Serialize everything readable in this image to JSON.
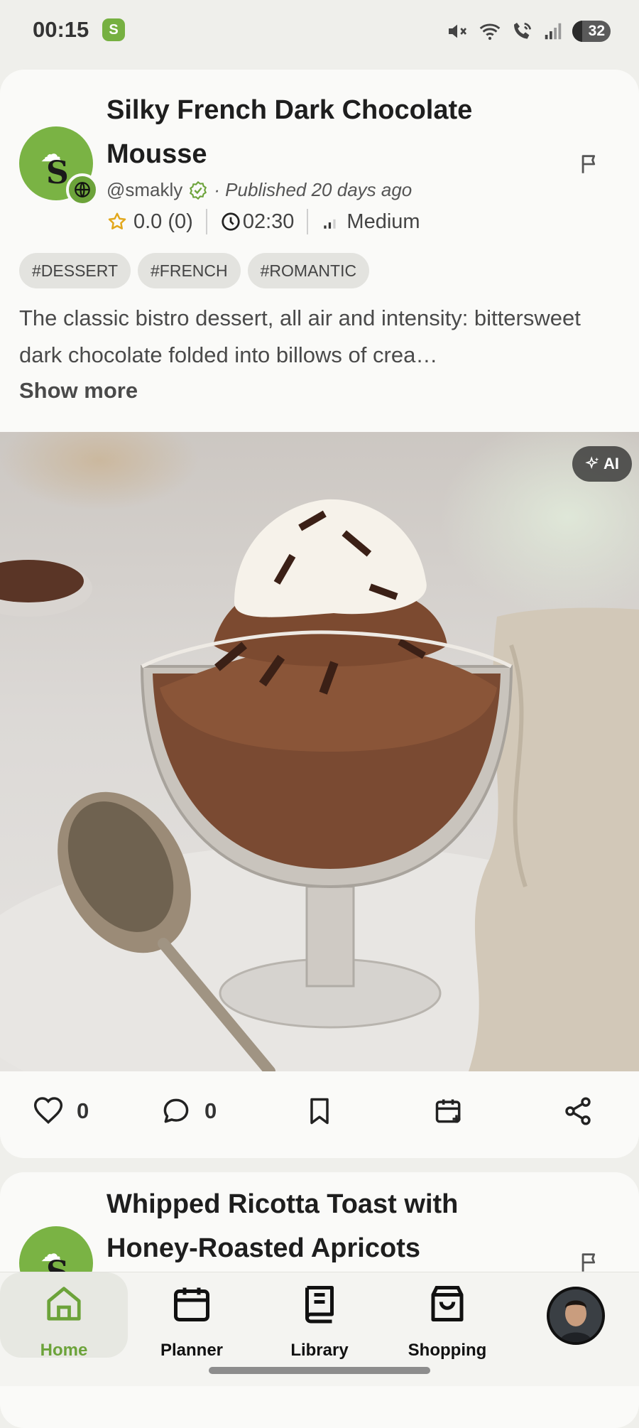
{
  "status_bar": {
    "time": "00:15",
    "battery": "32",
    "app_icon_letter": "S"
  },
  "recipe": {
    "title_line1": "Silky French Dark Chocolate",
    "title_line2": "Mousse",
    "author": "@smakly",
    "published": "· Published 20 days ago",
    "rating": "0.0 (0)",
    "time": "02:30",
    "difficulty": "Medium",
    "tags": [
      "#DESSERT",
      "#FRENCH",
      "#ROMANTIC"
    ],
    "description": "The classic bistro dessert, all air and intensity: bittersweet dark chocolate folded into billows of crea…",
    "show_more": "Show more",
    "ai_badge": "AI",
    "likes": "0",
    "comments": "0"
  },
  "next_recipe": {
    "title_line1": "Whipped Ricotta Toast with",
    "title_line2": "Honey-Roasted Apricots"
  },
  "nav": {
    "home": "Home",
    "planner": "Planner",
    "library": "Library",
    "shopping": "Shopping"
  },
  "colors": {
    "brand_green": "#76b041",
    "active_label": "#6ca33a"
  }
}
